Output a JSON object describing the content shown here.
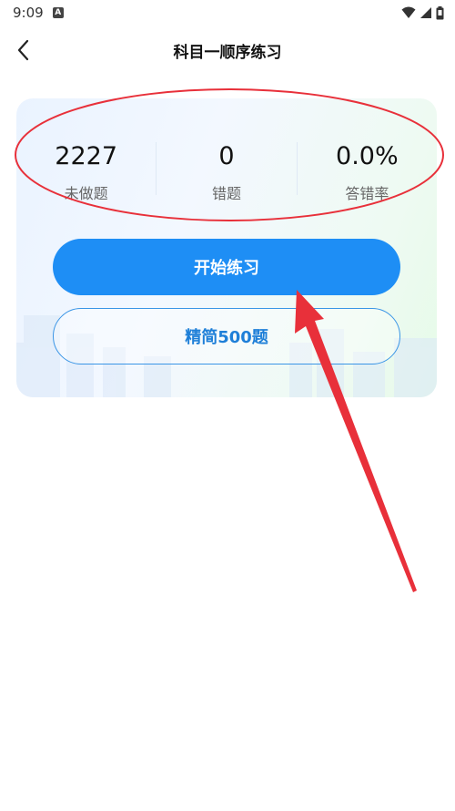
{
  "status_bar": {
    "time": "9:09",
    "app_icon_letter": "A",
    "icons": [
      "wifi-icon",
      "signal-icon",
      "battery-icon"
    ]
  },
  "header": {
    "title": "科目一顺序练习",
    "back_icon": "chevron-left-icon"
  },
  "stats": [
    {
      "value": "2227",
      "label": "未做题"
    },
    {
      "value": "0",
      "label": "错题"
    },
    {
      "value": "0.0%",
      "label": "答错率"
    }
  ],
  "buttons": {
    "start_label": "开始练习",
    "simplified_label": "精简500题"
  },
  "colors": {
    "primary": "#1e8ef5",
    "annotation": "#e8303a"
  }
}
